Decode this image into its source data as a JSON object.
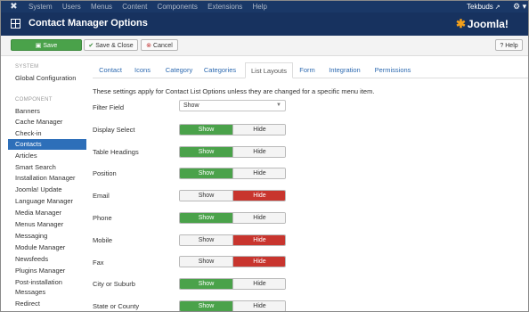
{
  "topbar": {
    "menu": [
      "System",
      "Users",
      "Menus",
      "Content",
      "Components",
      "Extensions",
      "Help"
    ],
    "user": "Tekbuds",
    "gear": "⚙ ▾"
  },
  "header": {
    "title": "Contact Manager Options",
    "brand": "Joomla!"
  },
  "toolbar": {
    "save": "Save",
    "save_close": "Save & Close",
    "cancel": "Cancel",
    "help": "Help"
  },
  "sidebar": {
    "system_heading": "SYSTEM",
    "global_config": "Global Configuration",
    "component_heading": "COMPONENT",
    "items": [
      "Banners",
      "Cache Manager",
      "Check-in",
      "Contacts",
      "Articles",
      "Smart Search",
      "Installation Manager",
      "Joomla! Update",
      "Language Manager",
      "Media Manager",
      "Menus Manager",
      "Messaging",
      "Module Manager",
      "Newsfeeds",
      "Plugins Manager",
      "Post-installation",
      "Messages",
      "Redirect"
    ],
    "active": "Contacts"
  },
  "tabs": [
    "Contact",
    "Icons",
    "Category",
    "Categories",
    "List Layouts",
    "Form",
    "Integration",
    "Permissions"
  ],
  "active_tab": "List Layouts",
  "intro": "These settings apply for Contact List Options unless they are changed for a specific menu item.",
  "filter_field": {
    "label": "Filter Field",
    "value": "Show"
  },
  "toggle_labels": {
    "show": "Show",
    "hide": "Hide"
  },
  "fields": [
    {
      "label": "Display Select",
      "value": "Show"
    },
    {
      "label": "Table Headings",
      "value": "Show"
    },
    {
      "label": "Position",
      "value": "Show"
    },
    {
      "label": "Email",
      "value": "Hide"
    },
    {
      "label": "Phone",
      "value": "Show"
    },
    {
      "label": "Mobile",
      "value": "Hide"
    },
    {
      "label": "Fax",
      "value": "Hide"
    },
    {
      "label": "City or Suburb",
      "value": "Show"
    },
    {
      "label": "State or County",
      "value": "Show"
    }
  ],
  "colors": {
    "topbar": "#1a3867",
    "header": "#17325f",
    "show_active": "#4aa24a",
    "hide_active": "#c8352e",
    "sidebar_active": "#2d6fb9",
    "link": "#2c69b0"
  }
}
